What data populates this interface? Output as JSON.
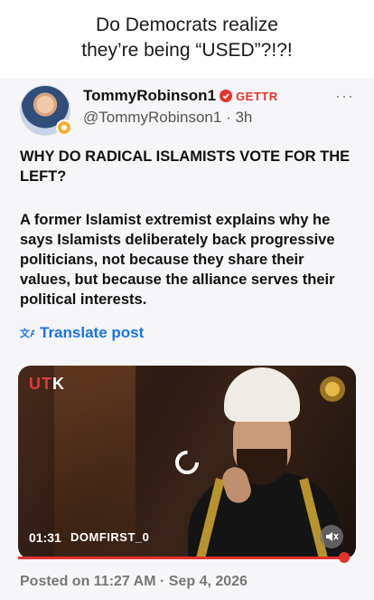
{
  "caption": {
    "line1": "Do Democrats realize",
    "line2": "they’re being “USED”?!?!"
  },
  "post": {
    "author_name": "TommyRobinson1",
    "brand": "GETTR",
    "handle": "@TommyRobinson1",
    "time_sep": "·",
    "age": "3h",
    "menu": "···",
    "headline": "WHY DO RADICAL ISLAMISTS VOTE FOR THE LEFT?",
    "body": "A former Islamist extremist explains why he says Islamists deliberately back progressive politicians, not because they share their values, but because the alliance serves their political interests.",
    "translate_label": "Translate post",
    "posted": "Posted on 11:27 AM · Sep 4, 2026"
  },
  "video": {
    "logo_left": "UT",
    "logo_right": "K",
    "time": "01:31",
    "channel": "DOMFIRST_0",
    "progress": 0.98
  },
  "colors": {
    "accent_blue": "#1a73e8",
    "brand_red": "#e5322d"
  }
}
